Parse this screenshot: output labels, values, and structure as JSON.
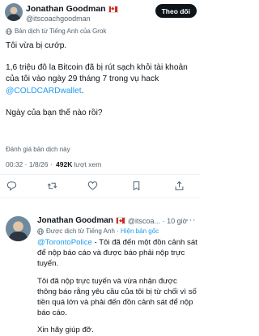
{
  "main_post": {
    "author_name": "Jonathan Goodman",
    "author_handle": "@itscoachgoodman",
    "follow_label": "Theo dõi",
    "translate_note": "Bản dịch từ Tiếng Anh của Grok",
    "body_line1": "Tôi vừa bị cướp.",
    "body_line2": "1,6 triệu đô la Bitcoin đã bị rút sạch khỏi tài khoản của tôi vào ngày 29 tháng 7 trong vụ hack",
    "body_mention": "@COLDCARDwallet",
    "body_mention_tail": ".",
    "body_line3": "Ngày của bạn thế nào rồi?",
    "rate_translation": "Đánh giá bản dịch này",
    "time": "00:32",
    "date": "1/8/26",
    "views": "492K",
    "views_label": "lượt xem"
  },
  "reply_post": {
    "author_name": "Jonathan Goodman",
    "author_handle": "@itscoa...",
    "age": "10 giờ",
    "translate_note": "Được dịch từ Tiếng Anh",
    "show_original": "Hiện bản gốc",
    "mention": "@TorontoPolice",
    "para1": " - Tôi đã đến một đồn cảnh sát để nộp báo cáo và được báo phải nộp trực tuyến.",
    "para2": "Tôi đã nộp trực tuyến và vừa nhận được thông báo rằng yêu cầu của tôi bị từ chối vì số tiền quá lớn và phải đến đồn cảnh sát để nộp báo cáo.",
    "para3": "Xin hãy giúp đỡ."
  },
  "colors": {
    "link": "#1d9bf0",
    "text": "#0f1419",
    "muted": "#536471",
    "follow_bg": "#0f1419"
  }
}
